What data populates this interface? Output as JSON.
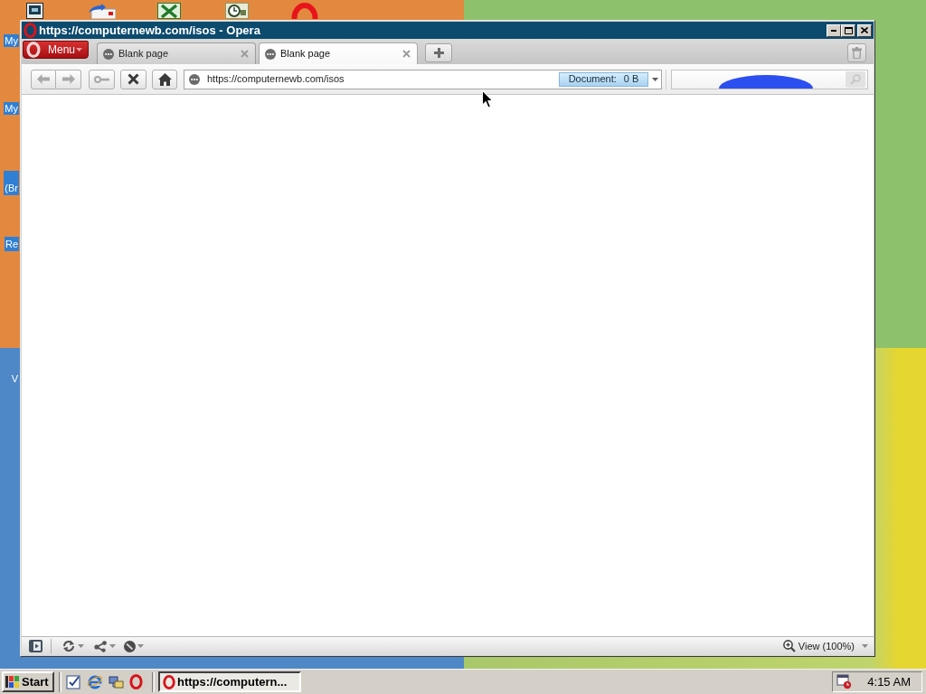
{
  "desktop": {
    "icon_labels": [
      "My",
      "My",
      "(Br",
      "Re",
      "V"
    ]
  },
  "window": {
    "title": "https://computernewb.com/isos - Opera",
    "menu_button": "Menu",
    "tabs": [
      {
        "label": "Blank page",
        "selected": false
      },
      {
        "label": "Blank page",
        "selected": true
      }
    ],
    "toolbar": [
      {
        "kind": "back",
        "disabled": true
      },
      {
        "kind": "forward",
        "disabled": true
      },
      {
        "kind": "key",
        "disabled": true
      },
      {
        "kind": "stop",
        "disabled": false
      },
      {
        "kind": "home",
        "disabled": false
      }
    ],
    "address_bar": {
      "value": "https://computernewb.com/isos",
      "progress_label": "Document:",
      "progress_value": "0 B"
    },
    "status_bar": {
      "zoom": "View (100%)"
    }
  },
  "taskbar": {
    "start": "Start",
    "tasks": [
      {
        "label": "https://computern...",
        "selected": true
      }
    ],
    "clock": "4:15 AM"
  }
}
